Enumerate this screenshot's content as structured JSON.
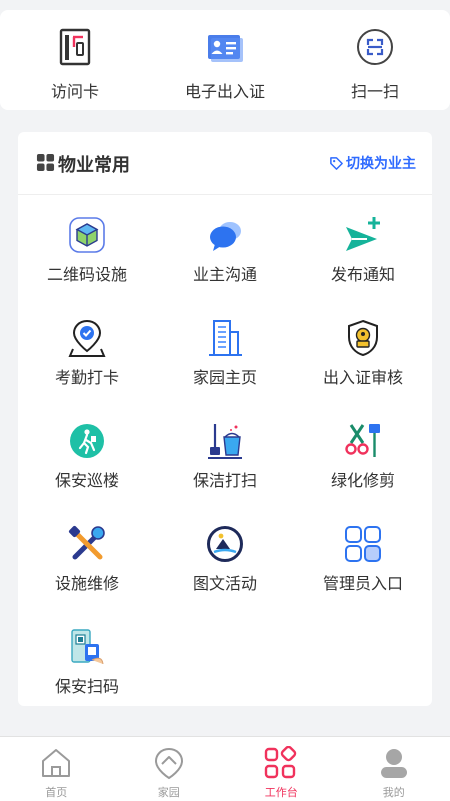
{
  "quick_actions": [
    {
      "label": "访问卡",
      "icon": "visitor-card-icon"
    },
    {
      "label": "电子出入证",
      "icon": "electronic-pass-icon"
    },
    {
      "label": "扫一扫",
      "icon": "scan-icon"
    }
  ],
  "section": {
    "title": "物业常用",
    "switch_label": "切换为业主",
    "title_icon": "grid-icon",
    "switch_icon": "tag-icon"
  },
  "services": [
    {
      "label": "二维码设施",
      "icon": "qr-facility-icon"
    },
    {
      "label": "业主沟通",
      "icon": "chat-bubble-icon"
    },
    {
      "label": "发布通知",
      "icon": "send-notice-icon"
    },
    {
      "label": "考勤打卡",
      "icon": "attendance-check-icon"
    },
    {
      "label": "家园主页",
      "icon": "building-icon"
    },
    {
      "label": "出入证审核",
      "icon": "pass-review-icon"
    },
    {
      "label": "保安巡楼",
      "icon": "security-patrol-icon"
    },
    {
      "label": "保洁打扫",
      "icon": "cleaning-icon"
    },
    {
      "label": "绿化修剪",
      "icon": "pruning-icon"
    },
    {
      "label": "设施维修",
      "icon": "repair-tools-icon"
    },
    {
      "label": "图文活动",
      "icon": "activity-icon"
    },
    {
      "label": "管理员入口",
      "icon": "admin-entry-icon"
    },
    {
      "label": "保安扫码",
      "icon": "security-scan-icon"
    }
  ],
  "tabs": [
    {
      "label": "首页",
      "icon": "home-icon",
      "active": false
    },
    {
      "label": "家园",
      "icon": "community-icon",
      "active": false
    },
    {
      "label": "工作台",
      "icon": "workbench-icon",
      "active": true
    },
    {
      "label": "我的",
      "icon": "profile-icon",
      "active": false
    }
  ],
  "colors": {
    "accent_blue": "#2f6bff",
    "tab_active": "#f0325c",
    "tab_inactive": "#9a9a9a",
    "background": "#f2f3f5"
  }
}
